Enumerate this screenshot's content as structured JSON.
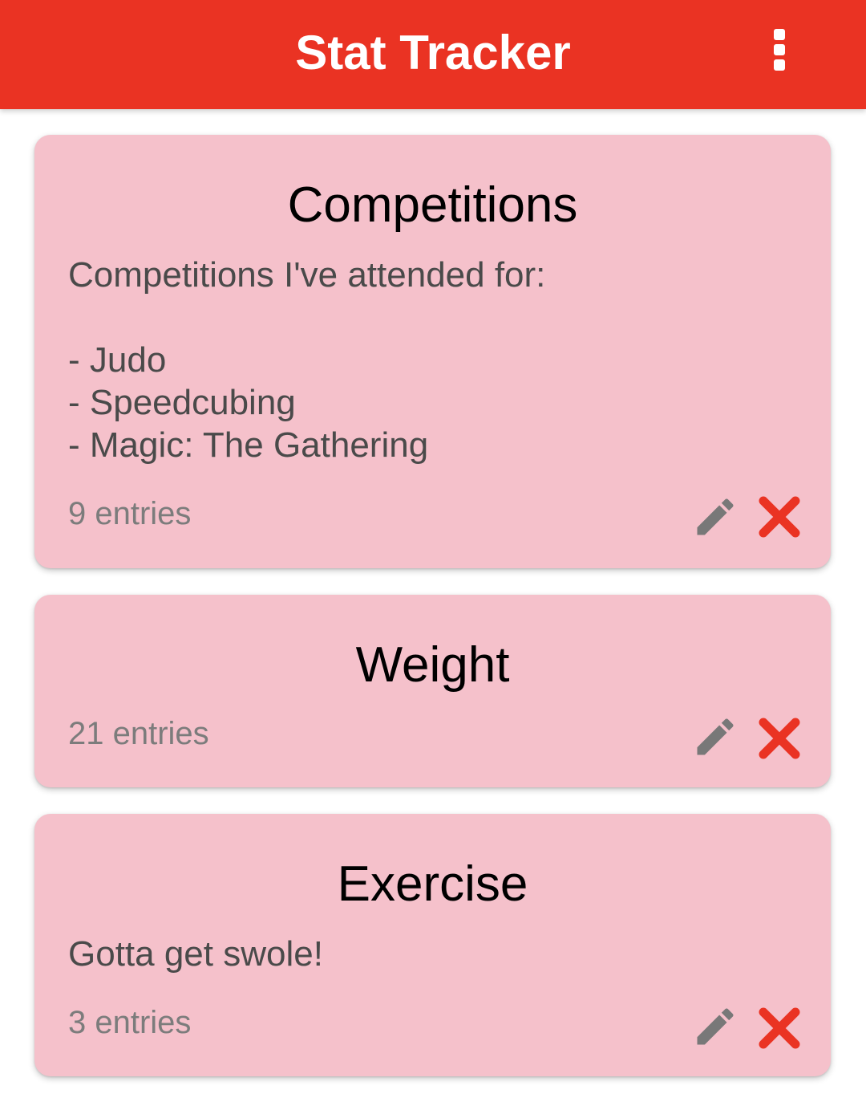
{
  "app_bar": {
    "title": "Stat Tracker",
    "menu_icon": "more-vert-icon",
    "color": "#ea3323"
  },
  "stats": [
    {
      "title": "Competitions",
      "description": "Competitions I've attended for:\n\n- Judo\n- Speedcubing\n- Magic: The Gathering",
      "entries": "9 entries",
      "edit_icon": "pencil-icon",
      "delete_icon": "close-icon"
    },
    {
      "title": "Weight",
      "description": "",
      "entries": "21 entries",
      "edit_icon": "pencil-icon",
      "delete_icon": "close-icon"
    },
    {
      "title": "Exercise",
      "description": "Gotta get swole!",
      "entries": "3 entries",
      "edit_icon": "pencil-icon",
      "delete_icon": "close-icon"
    }
  ],
  "colors": {
    "card_background": "#f5c1cb",
    "edit_icon": "#787878",
    "delete_icon": "#ea3323"
  }
}
